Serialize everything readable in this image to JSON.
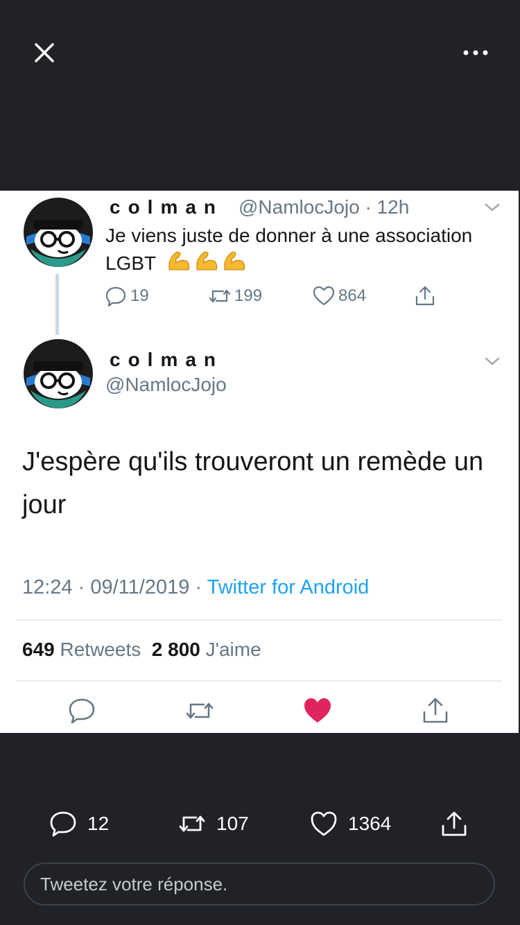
{
  "top_bar": {
    "close_icon": "close-icon",
    "more_icon": "more-horizontal-icon"
  },
  "screenshot": {
    "quoted_tweet": {
      "display_name": "colman",
      "handle": "@NamlocJojo",
      "time": "· 12h",
      "text": "Je viens juste de donner à une association LGBT",
      "emojis": "💪💪💪",
      "replies": "19",
      "retweets": "199",
      "likes": "864"
    },
    "main_tweet": {
      "display_name": "colman",
      "handle": "@NamlocJojo",
      "text": "J'espère qu'ils trouveront un remède un jour",
      "timestamp": "12:24 · 09/11/2019 · ",
      "source": "Twitter for Android",
      "retweet_count": "649",
      "retweet_label": "Retweets",
      "like_count": "2 800",
      "like_label": "J'aime"
    },
    "colors": {
      "heart": "#e0245e",
      "link": "#1da1f2",
      "muted": "#657786"
    }
  },
  "bottom_bar": {
    "replies": "12",
    "retweets": "107",
    "likes": "1364"
  },
  "reply": {
    "placeholder": "Tweetez votre réponse."
  }
}
